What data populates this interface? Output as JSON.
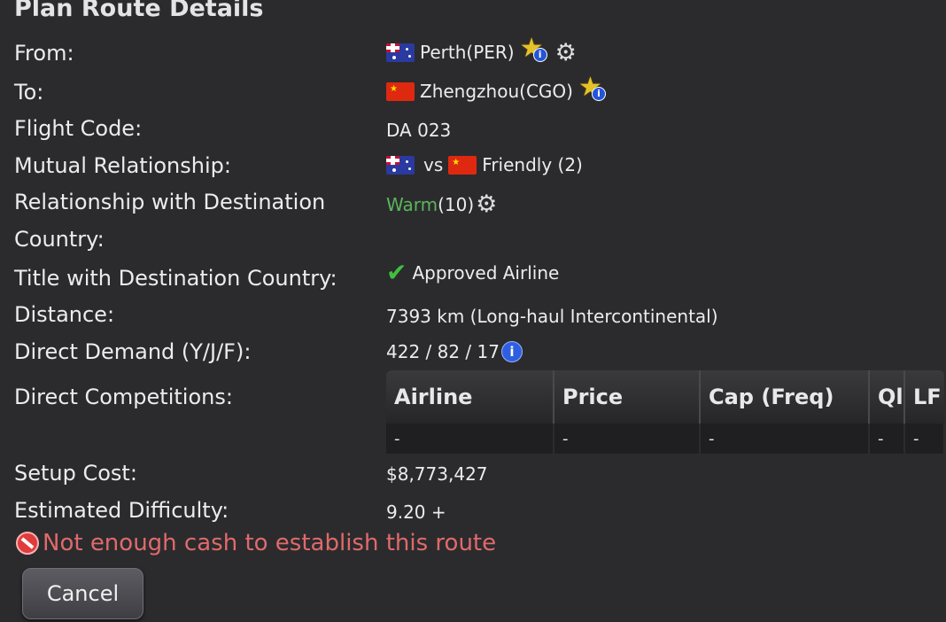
{
  "title": "Plan Route Details",
  "labels": {
    "from": "From:",
    "to": "To:",
    "flight_code": "Flight Code:",
    "mutual_relationship": "Mutual Relationship:",
    "relationship_destination_line1": "Relationship with Destination",
    "relationship_destination_line2": "Country:",
    "title_destination": "Title with Destination Country:",
    "distance": "Distance:",
    "direct_demand": "Direct Demand (Y/J/F):",
    "direct_competitions": "Direct Competitions:",
    "setup_cost": "Setup Cost:",
    "estimated_difficulty": "Estimated Difficulty:"
  },
  "values": {
    "from": "Perth(PER)",
    "to": "Zhengzhou(CGO)",
    "flight_code": "DA 023",
    "mutual_vs": "vs",
    "mutual_status": "Friendly (2)",
    "relationship_status": "Warm",
    "relationship_score": "(10)",
    "title_status": "Approved Airline",
    "distance": "7393 km (Long-haul Intercontinental)",
    "direct_demand": "422 / 82 / 17",
    "setup_cost": "$8,773,427",
    "estimated_difficulty": "9.20 +"
  },
  "competitions": {
    "headers": [
      "Airline",
      "Price",
      "Cap (Freq)",
      "Ql",
      "LF"
    ],
    "rows": [
      [
        "-",
        "-",
        "-",
        "-",
        "-"
      ]
    ]
  },
  "warning": "Not enough cash to establish this route",
  "buttons": {
    "cancel": "Cancel"
  },
  "icons": {
    "from_flag": "australia-flag-icon",
    "to_flag": "china-flag-icon",
    "airport_info": "star-info-icon",
    "settings": "gear-icon",
    "approved": "checkmark-icon",
    "demand_info": "info-icon",
    "warning": "no-entry-icon"
  },
  "colors": {
    "warm": "#5ab55a",
    "warning": "#e06a6a",
    "check": "#3fbf3f"
  }
}
